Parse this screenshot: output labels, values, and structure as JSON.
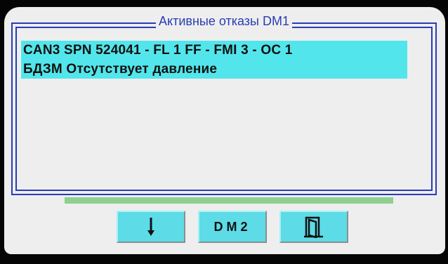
{
  "panel": {
    "title": "Активные отказы DM1"
  },
  "faults": [
    {
      "line1": "CAN3 SPN 524041 - FL 1 FF - FMI 3 - OC 1",
      "line2": "БДЗМ Отсутствует давление"
    }
  ],
  "buttons": {
    "scroll_down_icon": "arrow-down-icon",
    "dm2_label": "DM2",
    "exit_icon": "door-exit-icon"
  },
  "colors": {
    "accent": "#2b3cb3",
    "highlight": "#52e6ec",
    "button": "#5ddbe6",
    "indicator": "#8fcf8f"
  }
}
